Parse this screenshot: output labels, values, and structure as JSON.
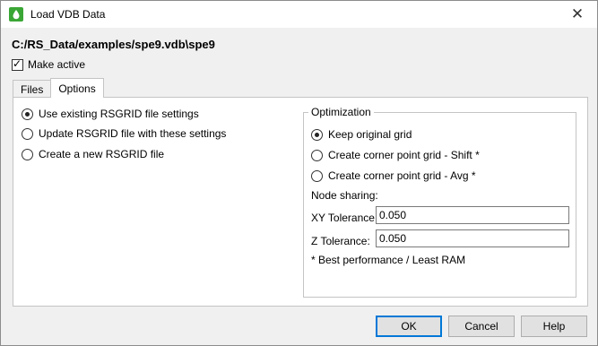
{
  "window": {
    "title": "Load VDB Data",
    "close_glyph": "✕",
    "app_icon": "green-drop-icon"
  },
  "header": {
    "path": "C:/RS_Data/examples/spe9.vdb\\spe9"
  },
  "make_active": {
    "label": "Make active",
    "checked": true
  },
  "tabs": [
    {
      "label": "Files",
      "active": false
    },
    {
      "label": "Options",
      "active": true
    }
  ],
  "options": {
    "rsgrid": [
      {
        "label": "Use existing RSGRID file settings",
        "checked": true
      },
      {
        "label": "Update RSGRID file with these settings",
        "checked": false
      },
      {
        "label": "Create a new RSGRID file",
        "checked": false
      }
    ],
    "optimization": {
      "title": "Optimization",
      "choices": [
        {
          "label": "Keep original grid",
          "checked": true
        },
        {
          "label": "Create corner point grid - Shift *",
          "checked": false
        },
        {
          "label": "Create corner point grid - Avg *",
          "checked": false
        }
      ],
      "node_sharing_label": "Node sharing:",
      "xy_tolerance_label": "XY Tolerance:",
      "xy_tolerance_value": "0.050",
      "z_tolerance_label": "Z Tolerance:",
      "z_tolerance_value": "0.050",
      "footnote": "* Best performance / Least RAM"
    }
  },
  "buttons": {
    "ok": "OK",
    "cancel": "Cancel",
    "help": "Help"
  },
  "colors": {
    "accent": "#0078d7",
    "icon_green": "#3aa635"
  }
}
